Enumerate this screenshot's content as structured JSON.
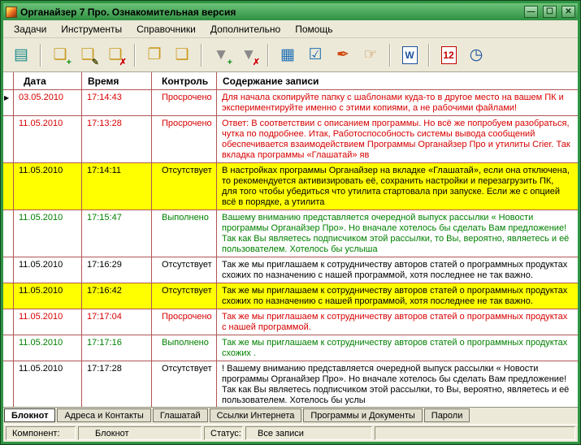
{
  "window": {
    "title": "Органайзер 7 Про. Ознакомительная версия",
    "minimize": "—",
    "maximize": "☐",
    "close": "✕"
  },
  "colors": {
    "frame_green": "#2f9444",
    "highlight_yellow": "#ffff00",
    "status_overdue_red": "#d80000",
    "status_done_green": "#008000",
    "status_missing_black": "#000000",
    "grid_line_red": "#b25555"
  },
  "menu": {
    "items": [
      {
        "name": "menu-tasks",
        "label": "Задачи"
      },
      {
        "name": "menu-tools",
        "label": "Инструменты"
      },
      {
        "name": "menu-references",
        "label": "Справочники"
      },
      {
        "name": "menu-additional",
        "label": "Дополнительно"
      },
      {
        "name": "menu-help",
        "label": "Помощь"
      }
    ]
  },
  "toolbar": {
    "groups": [
      [
        {
          "name": "basket-icon",
          "glyph": "▤",
          "color": "#1c8c8c"
        }
      ],
      [
        {
          "name": "add-note-icon",
          "glyph": "❏",
          "color": "#c99a1e",
          "badge": "+",
          "badge_color": "#0a8a0a"
        },
        {
          "name": "edit-note-icon",
          "glyph": "❏",
          "color": "#c99a1e",
          "badge": "✎",
          "badge_color": "#55500a"
        },
        {
          "name": "delete-note-icon",
          "glyph": "❏",
          "color": "#c99a1e",
          "badge": "✗",
          "badge_color": "#cc0000"
        }
      ],
      [
        {
          "name": "copy-note-icon",
          "glyph": "❐",
          "color": "#c99a1e"
        },
        {
          "name": "notes-list-icon",
          "glyph": "❑",
          "color": "#c99a1e"
        }
      ],
      [
        {
          "name": "filter-add-icon",
          "glyph": "▼",
          "color": "#8a8a8a",
          "badge": "+",
          "badge_color": "#0a8a0a"
        },
        {
          "name": "filter-remove-icon",
          "glyph": "▼",
          "color": "#8a8a8a",
          "badge": "✗",
          "badge_color": "#cc0000"
        }
      ],
      [
        {
          "name": "archive-box-icon",
          "glyph": "▦",
          "color": "#1f6fb5"
        },
        {
          "name": "tasks-check-icon",
          "glyph": "☑",
          "color": "#1f6fb5"
        },
        {
          "name": "stamp-icon",
          "glyph": "✒",
          "color": "#d04a10"
        },
        {
          "name": "hand-pointer-icon",
          "glyph": "☞",
          "color": "#c68642"
        }
      ],
      [
        {
          "name": "word-export-icon",
          "glyph": "W",
          "color": "#1a4f9c",
          "boxed": true
        }
      ],
      [
        {
          "name": "calendar-icon",
          "glyph": "12",
          "color": "#c00000",
          "boxed": true
        },
        {
          "name": "clock-icon",
          "glyph": "◷",
          "color": "#1a4f9c"
        }
      ]
    ]
  },
  "grid": {
    "headers": {
      "date": "Дата",
      "time": "Время",
      "control": "Контроль",
      "content": "Содержание записи"
    },
    "rows": [
      {
        "date": "03.05.2010",
        "time": "17:14:43",
        "control": "Просрочено",
        "color": "#d80000",
        "bg": "#ffffff",
        "marker": true,
        "content": "Для начала скопируйте папку с шаблонами куда-то в другое место на вашем ПК и экспериментируйте именно с этими копиями, а не рабочими файлами!"
      },
      {
        "date": "11.05.2010",
        "time": "17:13:28",
        "control": "Просрочено",
        "color": "#d80000",
        "bg": "#ffffff",
        "marker": false,
        "content": "Ответ: В соответствии с описанием программы. Но всё же попробуем разобраться, чутка по подробнее. Итак, Работоспособность системы вывода сообщений обеспечивается взаимодействием Программы Органайзер Про и утилиты Crier. Так вкладка программы «Глашатай» яв"
      },
      {
        "date": "11.05.2010",
        "time": "17:14:11",
        "control": "Отсутствует",
        "color": "#000000",
        "bg": "#ffff00",
        "marker": false,
        "content": "В настройках программы Органайзер на вкладке «Глашатай», если она отключена, то рекомендуется активизировать её, сохранить настройки и перезагрузить ПК, для того чтобы убедиться что утилита стартовала при запуске. Если же с опцией всё в порядке, а утилита"
      },
      {
        "date": "11.05.2010",
        "time": "17:15:47",
        "control": "Выполнено",
        "color": "#008000",
        "bg": "#ffffff",
        "marker": false,
        "content": "Вашему вниманию представляется очередной выпуск рассылки « Новости программы Органайзер Про». Но вначале хотелось бы сделать Вам предложение! Так как Вы являетесь подписчиком этой рассылки, то Вы, вероятно, являетесь и её пользователем. Хотелось бы услыша"
      },
      {
        "date": "11.05.2010",
        "time": "17:16:29",
        "control": "Отсутствует",
        "color": "#000000",
        "bg": "#ffffff",
        "marker": false,
        "content": "Так же мы приглашаем к сотрудничеству авторов статей о программных продуктах схожих по назначению  с нашей программой, хотя последнее не так важно."
      },
      {
        "date": "11.05.2010",
        "time": "17:16:42",
        "control": "Отсутствует",
        "color": "#000000",
        "bg": "#ffff00",
        "marker": false,
        "content": "Так же мы приглашаем к сотрудничеству авторов статей о программных продуктах схожих по назначению  с нашей программой, хотя последнее не так важно."
      },
      {
        "date": "11.05.2010",
        "time": "17:17:04",
        "control": "Просрочено",
        "color": "#d80000",
        "bg": "#ffffff",
        "marker": false,
        "content": "Так же мы приглашаем к сотрудничеству авторов статей о программных продуктах  с нашей программой."
      },
      {
        "date": "11.05.2010",
        "time": "17:17:16",
        "control": "Выполнено",
        "color": "#008000",
        "bg": "#ffffff",
        "marker": false,
        "content": "Так же мы приглашаем к сотрудничеству авторов статей о программных продуктах схожих ."
      },
      {
        "date": "11.05.2010",
        "time": "17:17:28",
        "control": "Отсутствует",
        "color": "#000000",
        "bg": "#ffffff",
        "marker": false,
        "content": "! Вашему вниманию представляется очередной выпуск рассылки « Новости программы Органайзер Про». Но вначале хотелось бы сделать Вам предложение! Так как Вы являетесь подписчиком этой рассылки, то Вы, вероятно, являетесь и её пользователем. Хотелось бы услы"
      }
    ]
  },
  "tabs": {
    "items": [
      {
        "name": "tab-notebook",
        "label": "Блокнот",
        "active": true
      },
      {
        "name": "tab-addresses-contacts",
        "label": "Адреса и Контакты",
        "active": false
      },
      {
        "name": "tab-herald",
        "label": "Глашатай",
        "active": false
      },
      {
        "name": "tab-internet-links",
        "label": "Ссылки Интернета",
        "active": false
      },
      {
        "name": "tab-programs-documents",
        "label": "Программы и Документы",
        "active": false
      },
      {
        "name": "tab-passwords",
        "label": "Пароли",
        "active": false
      }
    ]
  },
  "statusbar": {
    "component_label": "Компонент:",
    "component_value": "Блокнот",
    "status_label": "Статус:",
    "status_value": "Все записи"
  }
}
